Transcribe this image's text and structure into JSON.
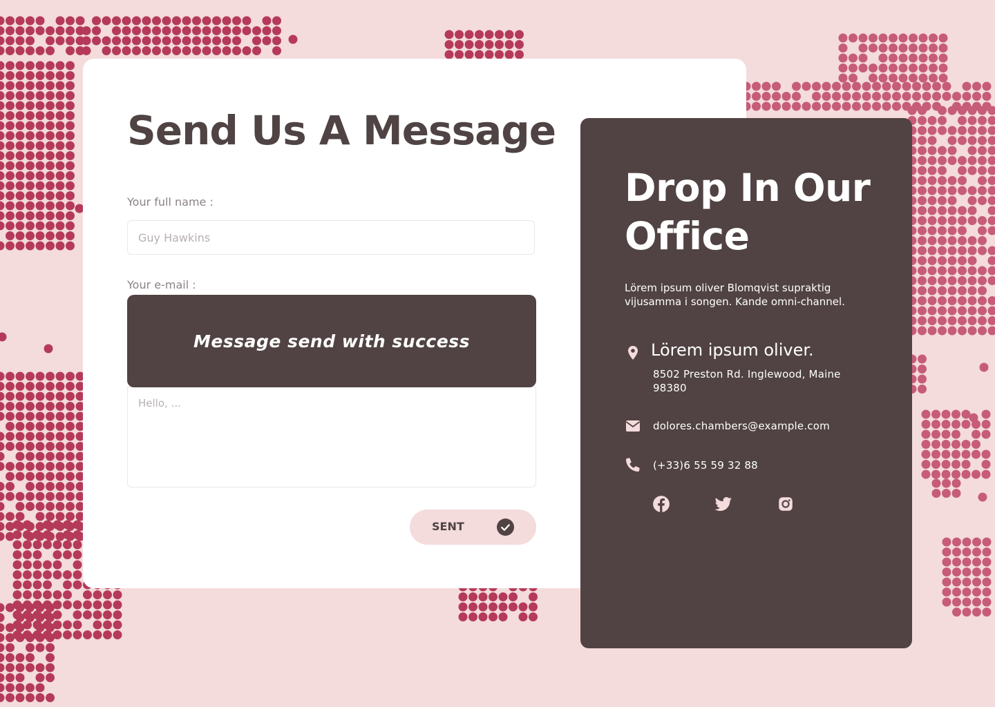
{
  "colors": {
    "background": "#f4dbdc",
    "map_dots": [
      "#b53a5a",
      "#c65c78"
    ],
    "card": "#ffffff",
    "dark_panel": "#514343",
    "heading": "#4f4343",
    "label": "#8c8383",
    "button_bg": "#f4dbdc"
  },
  "form": {
    "title": "Send Us A Message",
    "name_label": "Your full name :",
    "name_placeholder": "Guy Hawkins",
    "email_label": "Your e-mail :",
    "toast_message": "Message send with success",
    "message_placeholder": "Hello, ...",
    "submit_label": "SENT",
    "submit_icon": "check-circle-icon"
  },
  "office": {
    "title": "Drop In Our Office",
    "description": "Lörem ipsum oliver Blomqvist supraktig vijusamma i songen. Kande omni-channel.",
    "address_title": "Lörem ipsum oliver.",
    "address": "8502 Preston Rd. Inglewood, Maine 98380",
    "address_icon": "location-pin-icon",
    "email": "dolores.chambers@example.com",
    "email_icon": "envelope-icon",
    "phone": "(+33)6 55 59 32 88",
    "phone_icon": "phone-icon",
    "social": [
      "facebook-icon",
      "twitter-icon",
      "instagram-icon"
    ]
  }
}
